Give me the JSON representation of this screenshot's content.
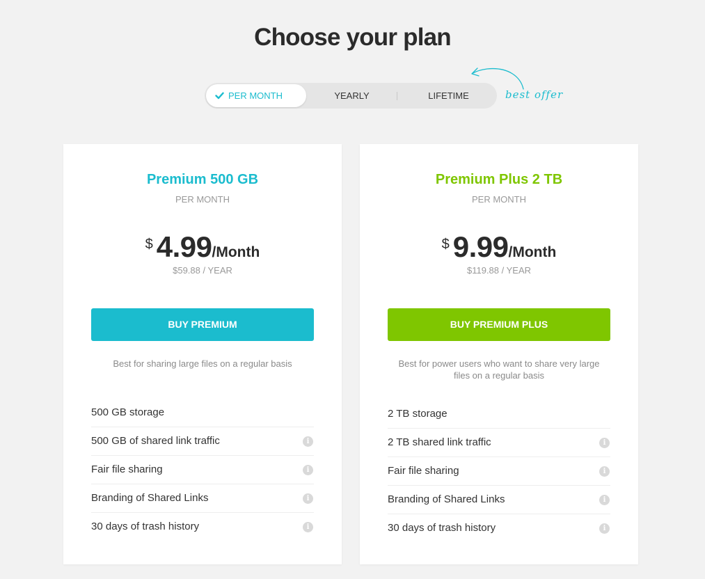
{
  "page": {
    "title": "Choose your plan"
  },
  "billing_toggle": {
    "options": [
      {
        "label": "PER MONTH",
        "selected": true
      },
      {
        "label": "YEARLY",
        "selected": false
      },
      {
        "label": "LIFETIME",
        "selected": false
      }
    ],
    "best_offer_label": "best offer"
  },
  "plans": [
    {
      "name": "Premium 500 GB",
      "period": "PER MONTH",
      "currency": "$",
      "price": "4.99",
      "unit": "/Month",
      "yearly_price": "$59.88 / YEAR",
      "button_label": "BUY PREMIUM",
      "description": "Best for sharing large files on a regular basis",
      "accent_color": "#1bbcce",
      "features": [
        {
          "label": "500 GB storage",
          "info": false
        },
        {
          "label": "500 GB of shared link traffic",
          "info": true
        },
        {
          "label": "Fair file sharing",
          "info": true
        },
        {
          "label": "Branding of Shared Links",
          "info": true
        },
        {
          "label": "30 days of trash history",
          "info": true
        }
      ]
    },
    {
      "name": "Premium Plus 2 TB",
      "period": "PER MONTH",
      "currency": "$",
      "price": "9.99",
      "unit": "/Month",
      "yearly_price": "$119.88 / YEAR",
      "button_label": "BUY PREMIUM PLUS",
      "description": "Best for power users who want to share very large files on a regular basis",
      "accent_color": "#7fc600",
      "features": [
        {
          "label": "2 TB storage",
          "info": false
        },
        {
          "label": "2 TB shared link traffic",
          "info": true
        },
        {
          "label": "Fair file sharing",
          "info": true
        },
        {
          "label": "Branding of Shared Links",
          "info": true
        },
        {
          "label": "30 days of trash history",
          "info": true
        }
      ]
    }
  ],
  "info_icon_glyph": "i",
  "colors": {
    "teal": "#1bbcce",
    "green": "#7fc600",
    "background": "#f2f2f2"
  }
}
